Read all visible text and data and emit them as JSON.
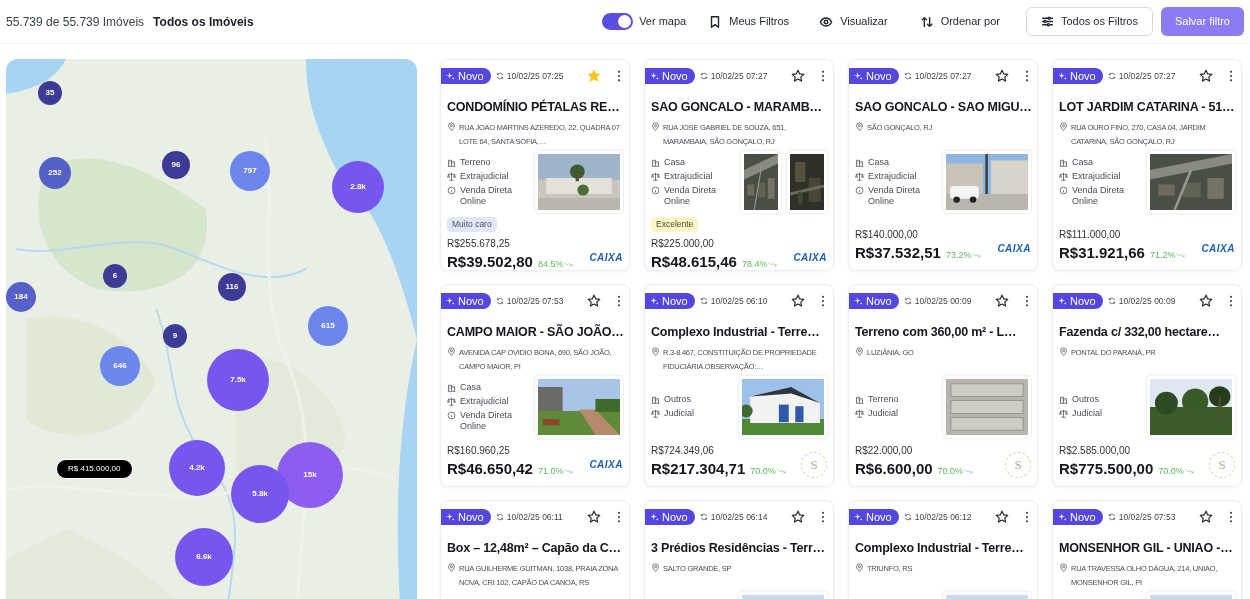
{
  "header": {
    "count_text": "55.739 de 55.739 Imóveis",
    "scope": "Todos os Imóveis",
    "map_toggle": {
      "label": "Ver mapa",
      "on": true
    },
    "actions": [
      {
        "kind": "saved",
        "label": "Meus Filtros"
      },
      {
        "kind": "view",
        "label": "Visualizar"
      },
      {
        "kind": "sort",
        "label": "Ordenar por"
      },
      {
        "kind": "filters",
        "label": "Todos os Filtros"
      },
      {
        "kind": "save",
        "label": "Salvar filtro"
      }
    ]
  },
  "map": {
    "clusters": [
      {
        "label": "35",
        "color": "#3d3b96"
      },
      {
        "label": "252",
        "color": "#5560c8"
      },
      {
        "label": "96",
        "color": "#3d3b96"
      },
      {
        "label": "797",
        "color": "#6c86ee"
      },
      {
        "label": "2.8k",
        "color": "#7656ee"
      },
      {
        "label": "6",
        "color": "#3d3b96"
      },
      {
        "label": "116",
        "color": "#3d3b96"
      },
      {
        "label": "184",
        "color": "#5560c8"
      },
      {
        "label": "615",
        "color": "#6c86ee"
      },
      {
        "label": "9",
        "color": "#3d3b96"
      },
      {
        "label": "646",
        "color": "#6c86ee"
      },
      {
        "label": "7.5k",
        "color": "#7656ee"
      },
      {
        "label": "4.2k",
        "color": "#7656ee"
      },
      {
        "label": "15k",
        "color": "#8d5cf0"
      },
      {
        "label": "5.8k",
        "color": "#7656ee"
      },
      {
        "label": "6.6k",
        "color": "#7656ee"
      }
    ],
    "price_pin": {
      "label": "R$ 415.000,00"
    }
  },
  "listings": [
    {
      "badge": "Novo",
      "date": "10/02/25 07:25",
      "favorite": true,
      "title": "CONDOMÍNIO PÉTALAS RE…",
      "address": "RUA JOAO MARTINS AZEREDO, 22, QUADRA 07 LOTE 64, SANTA SOFIA,…",
      "details": [
        {
          "kind": "type",
          "text": "Terreno"
        },
        {
          "kind": "modality",
          "text": "Extrajudicial"
        },
        {
          "kind": "sale",
          "text": "Venda Direta Online"
        }
      ],
      "photos": [
        {
          "kind": "picture"
        }
      ],
      "tag": {
        "kind": "expensive",
        "text": "Muito caro"
      },
      "original_price": "R$255.678,25",
      "price": "R$39.502,80",
      "discount": "84.5%",
      "logo": {
        "kind": "caixa",
        "text": "CAIXA"
      }
    },
    {
      "badge": "Novo",
      "date": "10/02/25 07:27",
      "favorite": false,
      "title": "SAO GONCALO - MARAMB…",
      "address": "RUA JOSE GABRIEL DE SOUZA, 651, MARAMBAIA, SÃO GONÇALO, RJ",
      "details": [
        {
          "kind": "type",
          "text": "Casa"
        },
        {
          "kind": "modality",
          "text": "Extrajudicial"
        },
        {
          "kind": "sale",
          "text": "Venda Direta Online"
        }
      ],
      "photos": [
        {
          "kind": "picture"
        },
        {
          "kind": "picture"
        }
      ],
      "tag": {
        "kind": "excellent",
        "text": "Excelente"
      },
      "original_price": "R$225.000,00",
      "price": "R$48.615,46",
      "discount": "78.4%",
      "logo": {
        "kind": "caixa",
        "text": "CAIXA"
      }
    },
    {
      "badge": "Novo",
      "date": "10/02/25 07:27",
      "favorite": false,
      "title": "SAO GONCALO - SAO MIGU…",
      "address": "SÃO GONÇALO, RJ",
      "details": [
        {
          "kind": "type",
          "text": "Casa"
        },
        {
          "kind": "modality",
          "text": "Extrajudicial"
        },
        {
          "kind": "sale",
          "text": "Venda Direta Online"
        }
      ],
      "photos": [
        {
          "kind": "picture"
        }
      ],
      "original_price": "R$140.000,00",
      "price": "R$37.532,51",
      "discount": "73.2%",
      "logo": {
        "kind": "caixa",
        "text": "CAIXA"
      }
    },
    {
      "badge": "Novo",
      "date": "10/02/25 07:27",
      "favorite": false,
      "title": "LOT JARDIM CATARINA - 51…",
      "address": "RUA OURO FINO, 270, CASA 04, JARDIM CATARINA, SÃO GONÇALO, RJ",
      "details": [
        {
          "kind": "type",
          "text": "Casa"
        },
        {
          "kind": "modality",
          "text": "Extrajudicial"
        },
        {
          "kind": "sale",
          "text": "Venda Direta Online"
        }
      ],
      "photos": [
        {
          "kind": "picture"
        }
      ],
      "original_price": "R$111.000,00",
      "price": "R$31.921,66",
      "discount": "71.2%",
      "logo": {
        "kind": "caixa",
        "text": "CAIXA"
      }
    },
    {
      "badge": "Novo",
      "date": "10/02/25 07:53",
      "favorite": false,
      "title": "CAMPO MAIOR - SÃO JOÃO…",
      "address": "AVENIDA CAP OVIDIO BONA, 690, SÃO JOÃO, CAMPO MAIOR, PI",
      "details": [
        {
          "kind": "type",
          "text": "Casa"
        },
        {
          "kind": "modality",
          "text": "Extrajudicial"
        },
        {
          "kind": "sale",
          "text": "Venda Direta Online"
        }
      ],
      "photos": [
        {
          "kind": "picture"
        }
      ],
      "original_price": "R$160.960,25",
      "price": "R$46.650,42",
      "discount": "71.0%",
      "logo": {
        "kind": "caixa",
        "text": "CAIXA"
      }
    },
    {
      "badge": "Novo",
      "date": "10/02/25 06:10",
      "favorite": false,
      "title": "Complexo Industrial - Terre…",
      "address": "R.3-8.467, CONSTITUIÇÃO DE PROPRIEDADE FIDUCIÁRIA.OBSERVAÇÃO:…",
      "details": [
        {
          "kind": "type",
          "text": "Outros"
        },
        {
          "kind": "modality",
          "text": "Judicial"
        }
      ],
      "photos": [
        {
          "kind": "picture"
        }
      ],
      "original_price": "R$724.349,06",
      "price": "R$217.304,71",
      "discount": "70.0%",
      "logo": {
        "kind": "seal",
        "text": "S"
      }
    },
    {
      "badge": "Novo",
      "date": "10/02/25 00:09",
      "favorite": false,
      "title": "Terreno com 360,00 m² - L…",
      "address": "LUZIÂNIA, GO",
      "details": [
        {
          "kind": "type",
          "text": "Terreno"
        },
        {
          "kind": "modality",
          "text": "Judicial"
        }
      ],
      "photos": [
        {
          "kind": "picture"
        }
      ],
      "original_price": "R$22.000,00",
      "price": "R$6.600,00",
      "discount": "70.0%",
      "logo": {
        "kind": "seal",
        "text": "S"
      }
    },
    {
      "badge": "Novo",
      "date": "10/02/25 00:09",
      "favorite": false,
      "title": "Fazenda c/ 332,00 hectare…",
      "address": "PONTAL DO PARANÁ, PR",
      "details": [
        {
          "kind": "type",
          "text": "Outros"
        },
        {
          "kind": "modality",
          "text": "Judicial"
        }
      ],
      "photos": [
        {
          "kind": "picture"
        }
      ],
      "original_price": "R$2.585.000,00",
      "price": "R$775.500,00",
      "discount": "70.0%",
      "logo": {
        "kind": "seal",
        "text": "S"
      }
    },
    {
      "badge": "Novo",
      "date": "10/02/25 06:11",
      "favorite": false,
      "title": "Box – 12,48m² – Capão da C…",
      "address": "RUA GUILHERME GUITMAN, 1038, PRAIA ZONA NOVA, CRI 102, CAPÃO DA CANOA, RS"
    },
    {
      "badge": "Novo",
      "date": "10/02/25 06:14",
      "favorite": false,
      "title": "3 Prédios Residências - Terr…",
      "address": "SALTO GRANDE, SP",
      "photos": [
        {
          "kind": "picture"
        }
      ]
    },
    {
      "badge": "Novo",
      "date": "10/02/25 06:12",
      "favorite": false,
      "title": "Complexo Industrial - Terre…",
      "address": "TRIUNFO, RS",
      "photos": [
        {
          "kind": "picture"
        }
      ]
    },
    {
      "badge": "Novo",
      "date": "10/02/25 07:53",
      "favorite": false,
      "title": "MONSENHOR GIL - UNIAO -…",
      "address": "RUA TRAVESSA OLHO DÁGUA, 214, UNIAO, MONSENHOR GIL, PI",
      "photos": [
        {
          "kind": "picture"
        }
      ]
    }
  ]
}
